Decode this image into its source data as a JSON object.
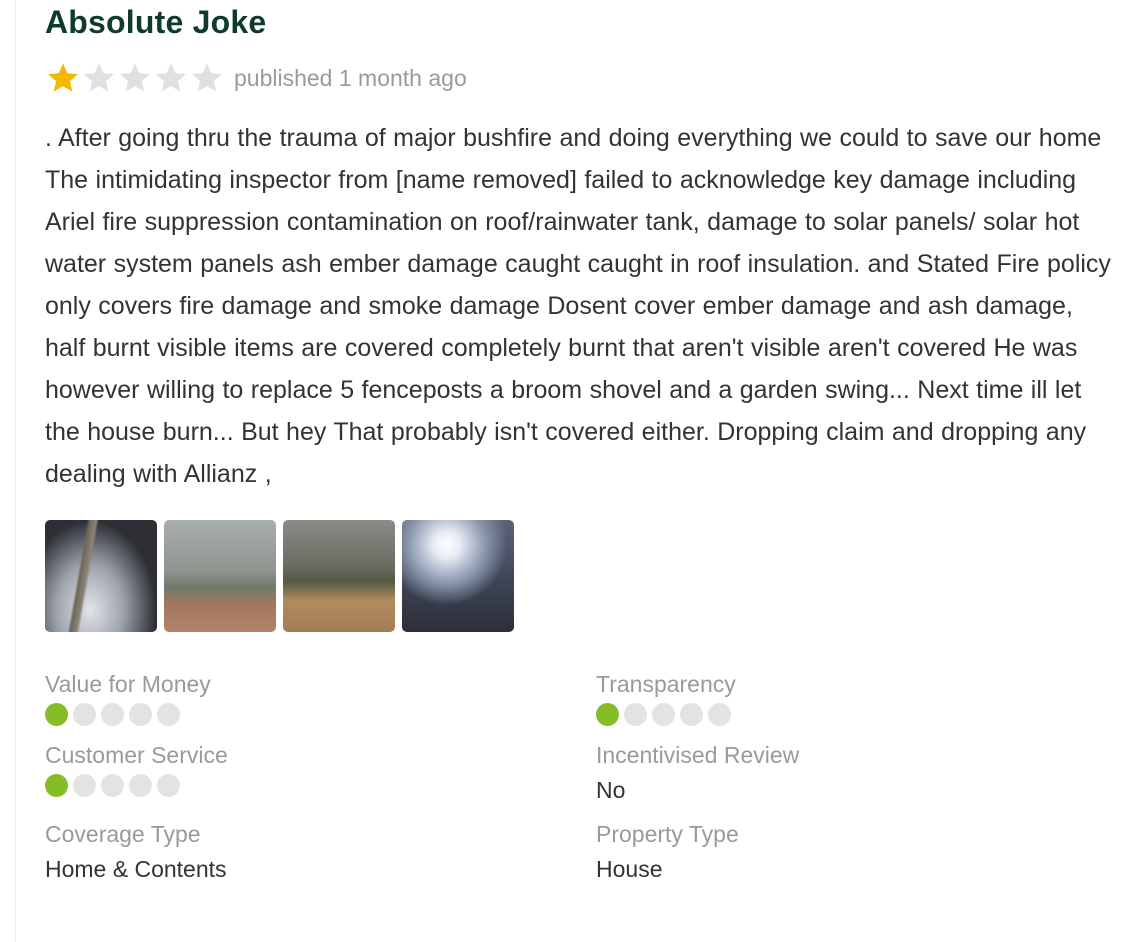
{
  "review": {
    "title": "Absolute Joke",
    "rating": 1,
    "rating_max": 5,
    "published": "published 1 month ago",
    "body": ". After going thru the trauma of major bushfire and doing everything we could to save our home The intimidating inspector from [name removed] failed to acknowledge key damage including Ariel fire suppression contamination on roof/rainwater tank, damage to solar panels/ solar hot water system panels ash ember damage caught caught in roof insulation. and Stated Fire policy only covers fire damage and smoke damage Dosent cover ember damage and ash damage, half burnt visible items are covered completely burnt that aren't visible aren't covered He was however willing to replace 5 fenceposts a broom shovel and a garden swing... Next time ill let the house burn... But hey That probably isn't covered either. Dropping claim and dropping any dealing with Allianz ,"
  },
  "photos": [
    "burnt-ground-photo",
    "smoky-yard-photo",
    "smoky-field-photo",
    "burnt-trees-photo"
  ],
  "ratings": {
    "value_for_money": {
      "label": "Value for Money",
      "score": 1,
      "max": 5
    },
    "transparency": {
      "label": "Transparency",
      "score": 1,
      "max": 5
    },
    "customer_service": {
      "label": "Customer Service",
      "score": 1,
      "max": 5
    },
    "incentivised_review": {
      "label": "Incentivised Review",
      "value": "No"
    },
    "coverage_type": {
      "label": "Coverage Type",
      "value": "Home & Contents"
    },
    "property_type": {
      "label": "Property Type",
      "value": "House"
    }
  },
  "colors": {
    "title": "#0f3b2c",
    "star_filled": "#f5b800",
    "star_empty": "#e0e0e0",
    "dot_filled": "#86bc25",
    "dot_empty": "#e3e3e3"
  }
}
